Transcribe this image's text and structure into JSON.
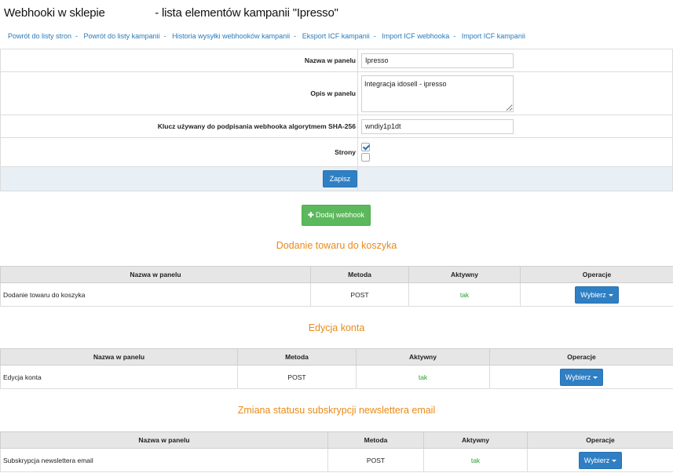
{
  "page": {
    "title_prefix": "Webhooki w sklepie",
    "title_suffix": "- lista elementów kampanii \"Ipresso\""
  },
  "breadcrumbs": [
    "Powrót do listy stron",
    "Powrót do listy kampanii",
    "Historia wysyłki webhooków kampanii",
    "Eksport ICF kampanii",
    "Import ICF webhooka",
    "Import ICF kampanii"
  ],
  "breadcrumb_separator": "-",
  "form": {
    "name_label": "Nazwa w panelu",
    "name_value": "Ipresso",
    "desc_label": "Opis w panelu",
    "desc_value": "Integracja idosell - ipresso",
    "key_label": "Klucz używany do podpisania webhooka algorytmem SHA-256",
    "key_value": "wndiy1p1dt",
    "stores_label": "Strony",
    "stores": [
      {
        "checked": true
      },
      {
        "checked": false
      }
    ],
    "save_label": "Zapisz"
  },
  "add_webhook_label": "Dodaj webhook",
  "table_headers": {
    "name": "Nazwa w panelu",
    "method": "Metoda",
    "active": "Aktywny",
    "operations": "Operacje"
  },
  "sections": [
    {
      "title": "Dodanie towaru do koszyka",
      "row": {
        "name": "Dodanie towaru do koszyka",
        "method": "POST",
        "active": "tak",
        "action": "Wybierz"
      }
    },
    {
      "title": "Edycja konta",
      "row": {
        "name": "Edycja konta",
        "method": "POST",
        "active": "tak",
        "action": "Wybierz"
      }
    },
    {
      "title": "Zmiana statusu subskrypcji newslettera email",
      "row": {
        "name": "Subskrypcja newslettera email",
        "method": "POST",
        "active": "tak",
        "action": "Wybierz"
      }
    }
  ],
  "colors": {
    "link": "#2a7ab8",
    "section_title": "#e88a1a",
    "primary_button": "#2f7fc4",
    "success_button": "#5cb85c",
    "active_text": "#2a9d2a"
  },
  "icons": {
    "add": "plus-icon",
    "dropdown": "caret-down-icon"
  }
}
